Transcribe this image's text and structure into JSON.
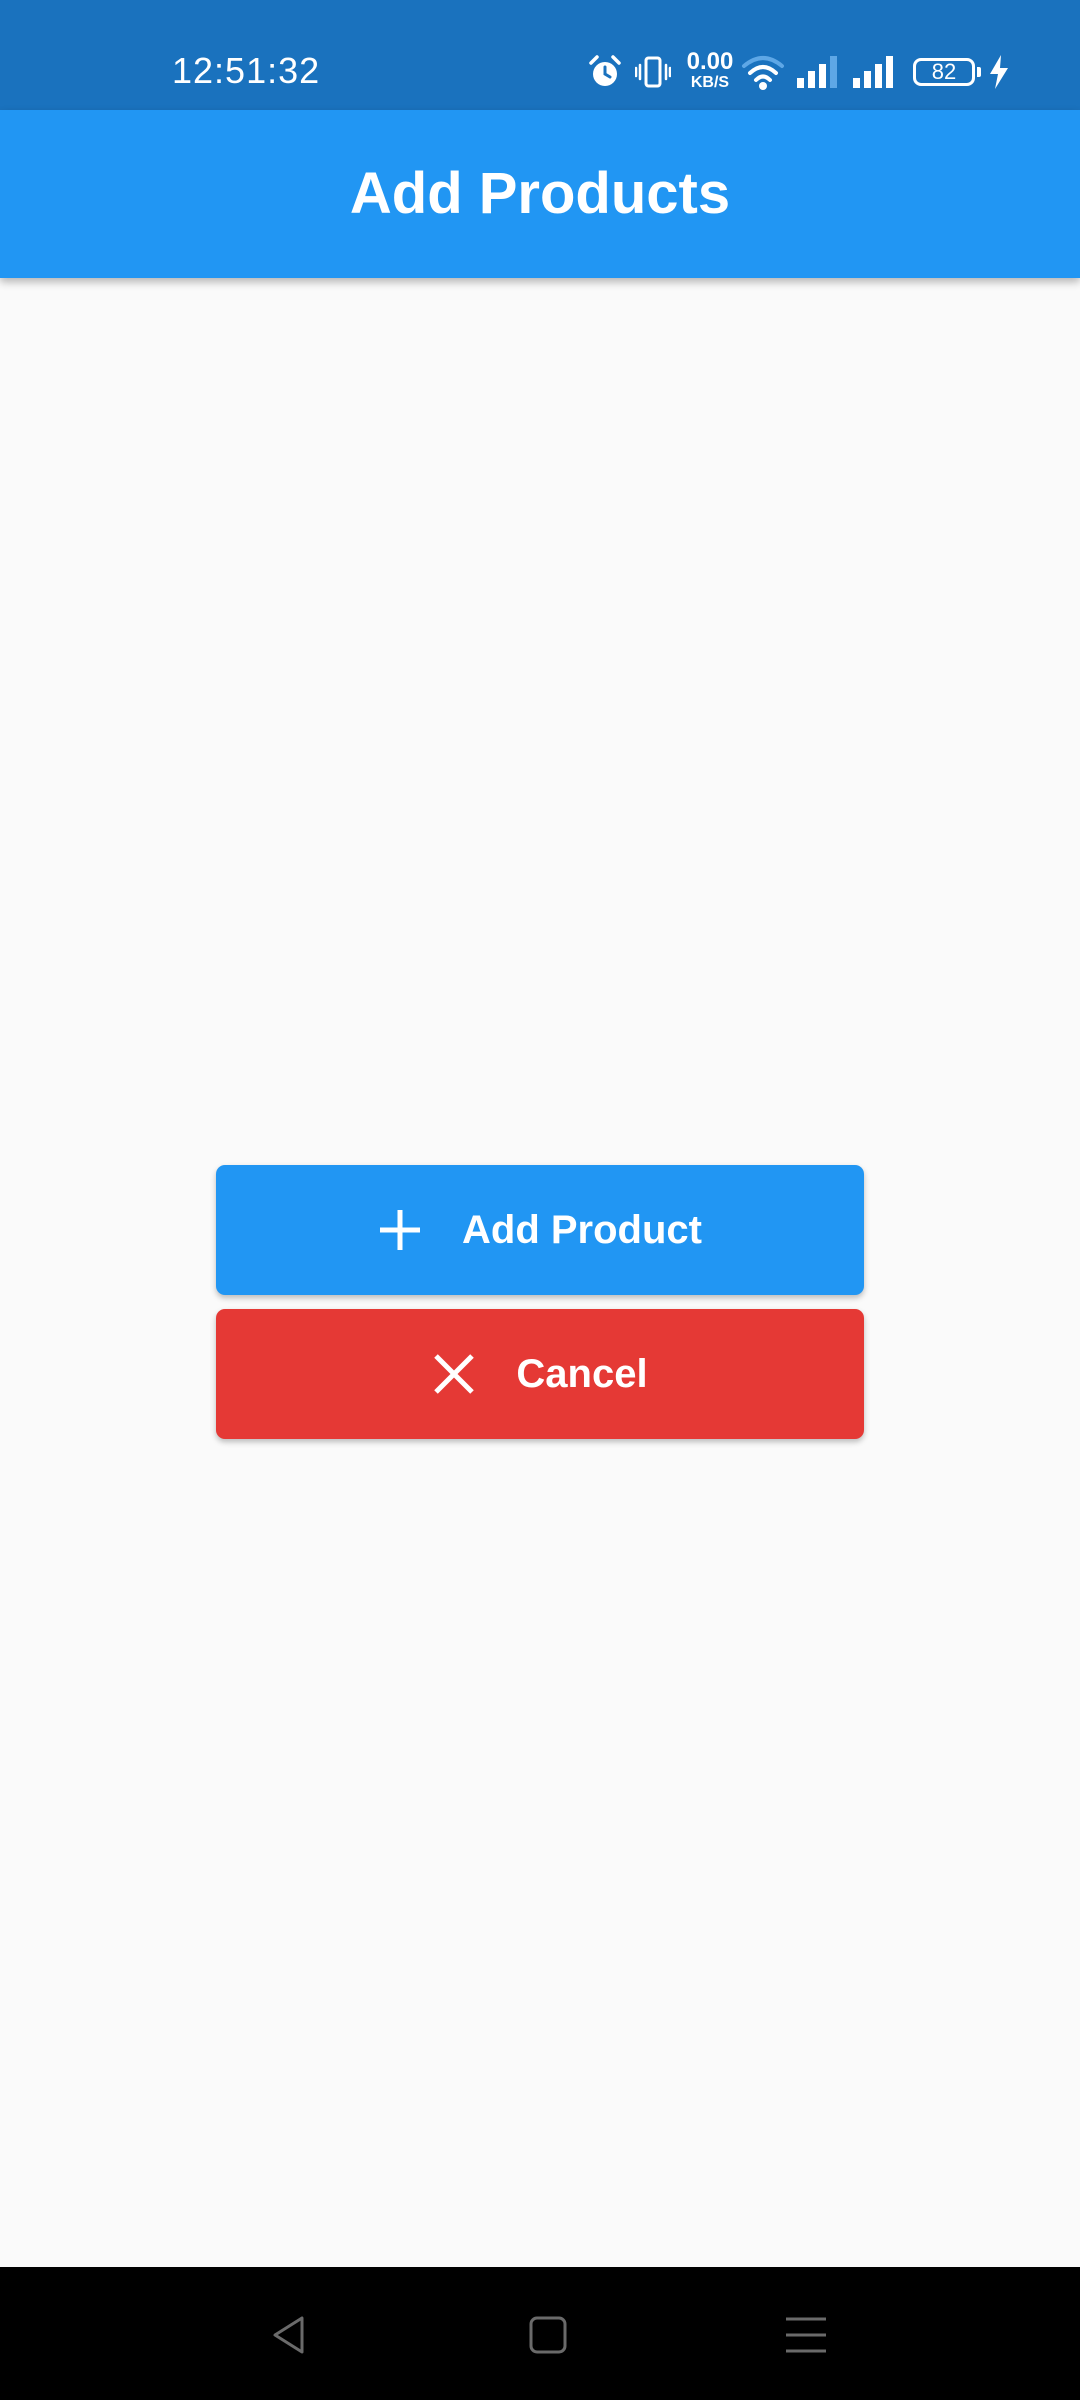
{
  "status_bar": {
    "time": "12:51:32",
    "network_speed_value": "0.00",
    "network_speed_unit": "KB/S",
    "battery_level": "82",
    "icons": [
      "alarm-icon",
      "vibrate-icon",
      "wifi-icon",
      "signal-icon",
      "signal-icon",
      "battery-icon",
      "charging-icon"
    ],
    "background_color": "#1a72be"
  },
  "app_bar": {
    "title": "Add Products",
    "background_color": "#2196f3"
  },
  "actions": {
    "add_product": {
      "label": "Add Product",
      "icon": "plus-icon",
      "color": "#2196f3"
    },
    "cancel": {
      "label": "Cancel",
      "icon": "close-icon",
      "color": "#e53935"
    }
  },
  "nav_bar": {
    "buttons": [
      "back-icon",
      "home-icon",
      "menu-icon"
    ]
  }
}
